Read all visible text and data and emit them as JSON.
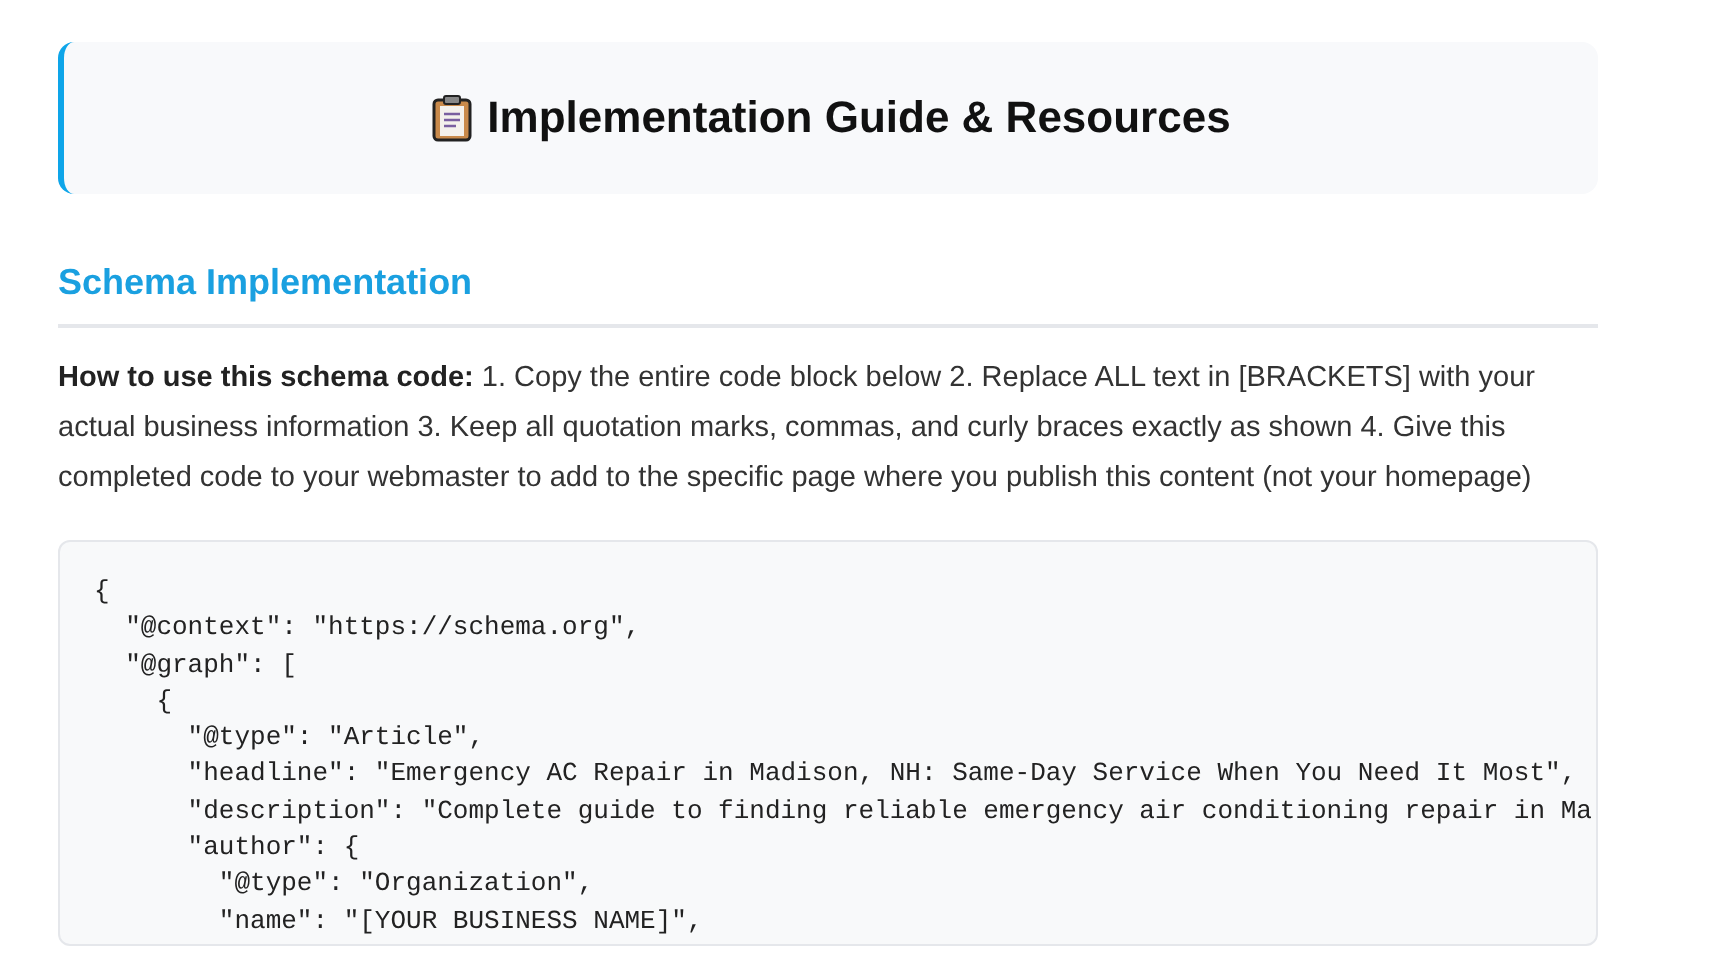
{
  "header": {
    "title": "Implementation Guide & Resources"
  },
  "section": {
    "heading": "Schema Implementation",
    "instructions": "**How to use this schema code:** 1. Copy the entire code block below 2. Replace ALL text in [BRACKETS] with your actual business information 3. Keep all quotation marks, commas, and curly braces exactly as shown 4. Give this completed code to your webmaster to add to the specific page where you publish this content (not your homepage)"
  },
  "code_lines": [
    "{",
    "  \"@context\": \"https://schema.org\",",
    "  \"@graph\": [",
    "    {",
    "      \"@type\": \"Article\",",
    "      \"headline\": \"Emergency AC Repair in Madison, NH: Same-Day Service When You Need It Most\",",
    "      \"description\": \"Complete guide to finding reliable emergency air conditioning repair in Ma",
    "      \"author\": {",
    "        \"@type\": \"Organization\",",
    "        \"name\": \"[YOUR BUSINESS NAME]\","
  ]
}
